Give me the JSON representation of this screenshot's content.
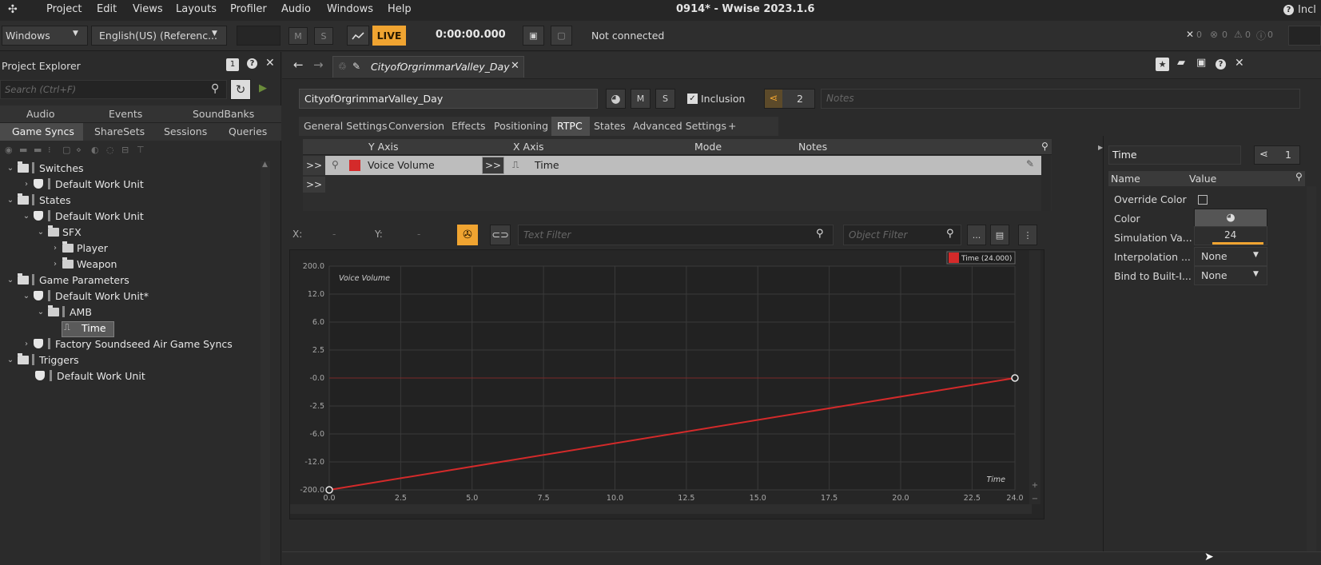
{
  "titlebar": {
    "menus": [
      "Project",
      "Edit",
      "Views",
      "Layouts",
      "Profiler",
      "Audio",
      "Windows",
      "Help"
    ],
    "title": "0914* - Wwise 2023.1.6",
    "right_label": "Incl"
  },
  "toolbar": {
    "platform": "Windows",
    "language": "English(US) (Referenc...",
    "m_label": "M",
    "s_label": "S",
    "live_label": "LIVE",
    "time": "0:00:00.000",
    "connection": "Not connected",
    "counts": [
      "0",
      "0",
      "0",
      "0"
    ]
  },
  "project_explorer": {
    "title": "Project Explorer",
    "badge": "1",
    "search_placeholder": "Search (Ctrl+F)",
    "tabs_row1": [
      "Audio",
      "Events",
      "SoundBanks"
    ],
    "tabs_row2": [
      "Game Syncs",
      "ShareSets",
      "Sessions",
      "Queries"
    ],
    "tree": [
      {
        "label": "Switches"
      },
      {
        "label": "Default Work Unit"
      },
      {
        "label": "States"
      },
      {
        "label": "Default Work Unit"
      },
      {
        "label": "SFX"
      },
      {
        "label": "Player"
      },
      {
        "label": "Weapon"
      },
      {
        "label": "Game Parameters"
      },
      {
        "label": "Default Work Unit*"
      },
      {
        "label": "AMB"
      },
      {
        "label": "Time"
      },
      {
        "label": "Factory Soundseed Air Game Syncs"
      },
      {
        "label": "Triggers"
      },
      {
        "label": "Default Work Unit"
      }
    ]
  },
  "editor": {
    "doc_tab": "CityofOrgrimmarValley_Day",
    "name_field": "CityofOrgrimmarValley_Day",
    "m_label": "M",
    "s_label": "S",
    "inclusion_label": "Inclusion",
    "share_count": "2",
    "notes_placeholder": "Notes",
    "tabs": [
      "General Settings",
      "Conversion",
      "Effects",
      "Positioning",
      "RTPC",
      "States",
      "Advanced Settings",
      "+"
    ],
    "rtpc_headers": {
      "y_axis": "Y Axis",
      "x_axis": "X Axis",
      "mode": "Mode",
      "notes": "Notes"
    },
    "rtpc_row": {
      "expand": ">>",
      "y_value": "Voice Volume",
      "x_expand": ">>",
      "x_value": "Time"
    },
    "rtpc_row2_expand": ">>",
    "filter": {
      "x_label": "X:",
      "x_value": "-",
      "y_label": "Y:",
      "y_value": "-",
      "text_filter_placeholder": "Text Filter",
      "object_filter_placeholder": "Object Filter",
      "more_label": "..."
    }
  },
  "chart_data": {
    "type": "line",
    "series": [
      {
        "name": "Voice Volume",
        "color": "#d42a2a",
        "points": [
          [
            0.0,
            -200.0
          ],
          [
            24.0,
            -0.0
          ]
        ]
      }
    ],
    "ylabel": "Voice Volume",
    "xlabel": "Time",
    "legend": "Time (24.000)",
    "x_ticks": [
      "0.0",
      "2.5",
      "5.0",
      "7.5",
      "10.0",
      "12.5",
      "15.0",
      "17.5",
      "20.0",
      "22.5",
      "24.0"
    ],
    "y_ticks": [
      "200.0",
      "12.0",
      "6.0",
      "2.5",
      "-0.0",
      "-2.5",
      "-6.0",
      "-12.0",
      "-200.0"
    ],
    "xlim": [
      0,
      24
    ],
    "ylim": [
      -200,
      200
    ],
    "grid": true
  },
  "properties": {
    "title_field": "Time",
    "share_count": "1",
    "headers": {
      "name": "Name",
      "value": "Value"
    },
    "rows": [
      {
        "name": "Override Color",
        "value": ""
      },
      {
        "name": "Color",
        "value": ""
      },
      {
        "name": "Simulation Va...",
        "value": "24"
      },
      {
        "name": "Interpolation ...",
        "value": "None"
      },
      {
        "name": "Bind to Built-I...",
        "value": "None"
      }
    ]
  },
  "colors": {
    "accent_orange": "#f0a431",
    "curve_red": "#d42a2a",
    "panel_bg": "#2b2b2b",
    "chart_bg": "#222222"
  }
}
